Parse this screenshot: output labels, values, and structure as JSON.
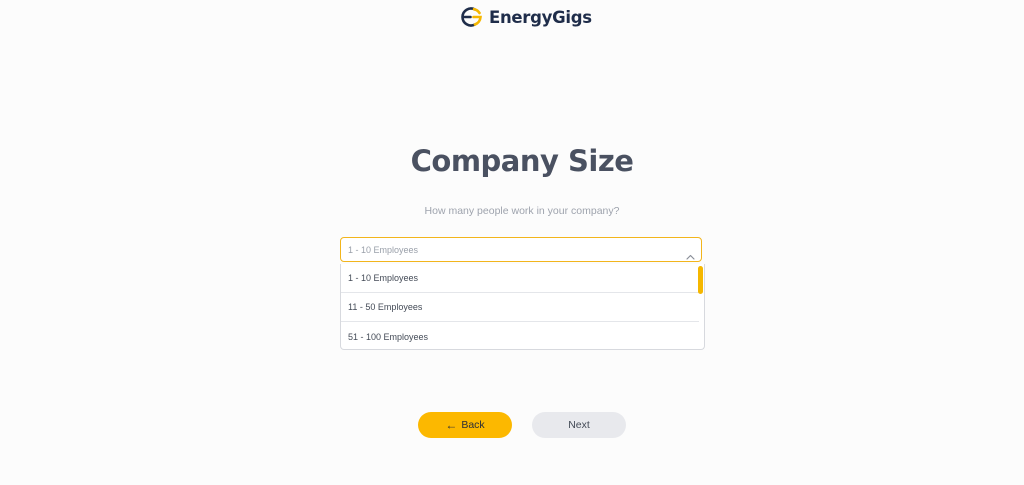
{
  "logo": {
    "text": "EnergyGigs",
    "colors": {
      "navy": "#1f2d4a",
      "accent": "#f5b700"
    }
  },
  "header": {
    "title": "Company Size",
    "subtitle": "How many people work in your company?"
  },
  "select": {
    "value": "1 - 10 Employees",
    "expanded": true,
    "options": [
      "1 - 10 Employees",
      "11 - 50 Employees",
      "51 - 100 Employees"
    ]
  },
  "buttons": {
    "back_label": "Back",
    "back_icon": "left-arrow-icon",
    "next_label": "Next"
  },
  "colors": {
    "accent": "#fcb800",
    "title": "#4a5161",
    "secondary_button": "#e8e9ed"
  }
}
